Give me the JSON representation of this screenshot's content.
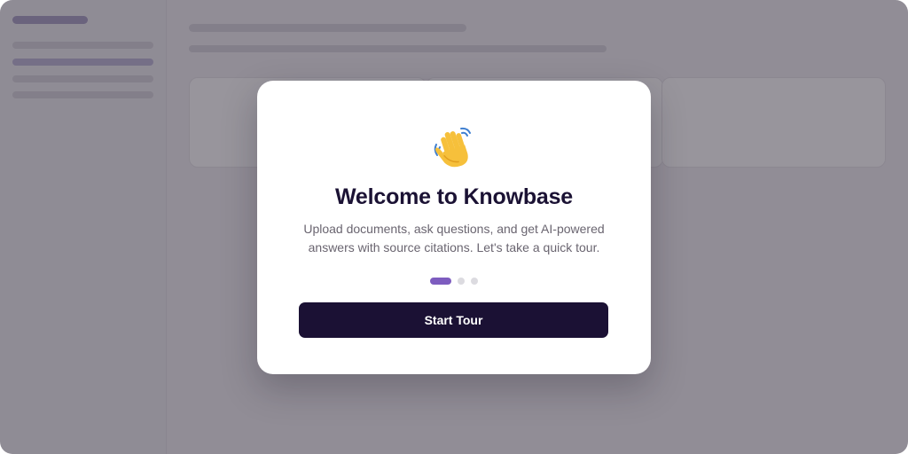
{
  "modal": {
    "icon": "waving-hand-icon",
    "title": "Welcome to Knowbase",
    "description_line1": "Upload documents, ask questions, and get AI-powered",
    "description_line2": "answers with source citations. Let's take a quick tour.",
    "steps": {
      "total": 3,
      "current": 1
    },
    "start_label": "Start Tour"
  },
  "colors": {
    "primary": "#1b1134",
    "accent": "#7d5cbf",
    "overlay": "rgba(40,34,48,0.48)"
  }
}
